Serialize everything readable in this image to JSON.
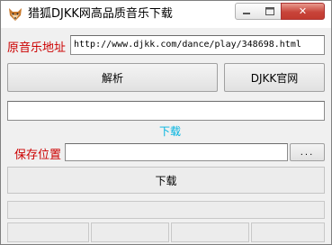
{
  "window": {
    "title": "猎狐DJKK网高品质音乐下载",
    "icon": "fox-app-icon"
  },
  "controls": {
    "minimize_icon": "minimize-icon",
    "maximize_icon": "maximize-icon",
    "close_icon": "close-icon",
    "close_glyph": "✕"
  },
  "source": {
    "label": "原音乐地址",
    "url_value": "http://www.djkk.com/dance/play/348698.html"
  },
  "actions": {
    "parse_label": "解析",
    "site_label": "DJKK官网"
  },
  "result": {
    "value": "",
    "download_link": "下载"
  },
  "save": {
    "label": "保存位置",
    "path_value": "",
    "browse_label": "..."
  },
  "download_button": "下载",
  "colors": {
    "label_red": "#cc0000",
    "link_cyan": "#00b4e0"
  }
}
